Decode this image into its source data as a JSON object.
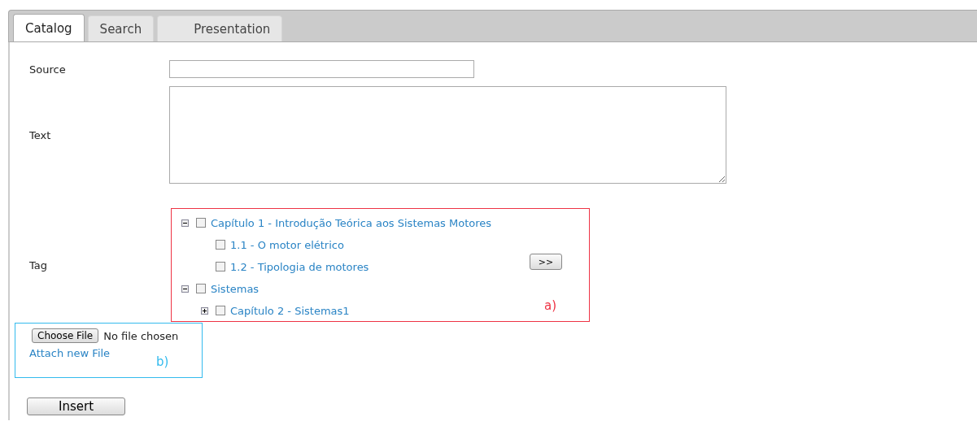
{
  "tabs": [
    {
      "label": "Catalog",
      "selected": true
    },
    {
      "label": "Search",
      "selected": false
    },
    {
      "label": "Presentation",
      "selected": false
    }
  ],
  "form": {
    "source": {
      "label": "Source"
    },
    "text": {
      "label": "Text"
    },
    "tag": {
      "label": "Tag"
    }
  },
  "tree": [
    {
      "label": "Capítulo 1 - Introdução Teórica aos Sistemas Motores",
      "checked": false,
      "expanded": true,
      "children": [
        {
          "label": "1.1 - O motor elétrico",
          "checked": false
        },
        {
          "label": "1.2 - Tipologia de motores",
          "checked": false
        }
      ]
    },
    {
      "label": "Sistemas",
      "checked": false,
      "expanded": true,
      "children": [
        {
          "label": "Capítulo 2 - Sistemas1",
          "checked": false,
          "expanded": false
        }
      ]
    }
  ],
  "move_button": ">>",
  "file": {
    "button": "Choose File",
    "status": "No file chosen",
    "link": "Attach new File"
  },
  "annotations": [
    {
      "label": "a)",
      "color": "#ee3344"
    },
    {
      "label": "b)",
      "color": "#33bbee"
    }
  ],
  "insert_button": "Insert"
}
